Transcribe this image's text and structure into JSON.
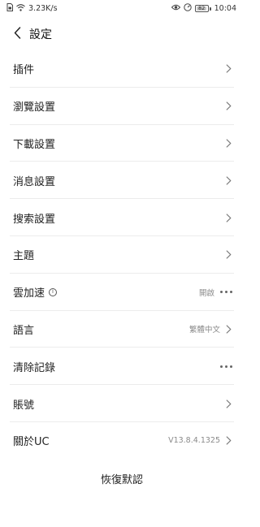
{
  "status_bar": {
    "network_speed": "3.23K/s",
    "battery_level": "82",
    "time": "10:04",
    "icons": [
      "sim-card-icon",
      "wifi-icon",
      "eye-icon",
      "speedometer-icon",
      "battery-icon"
    ]
  },
  "header": {
    "back_icon": "chevron-left-icon",
    "title": "設定"
  },
  "settings": {
    "plugins": {
      "label": "插件"
    },
    "browse": {
      "label": "瀏覽設置"
    },
    "download": {
      "label": "下載設置"
    },
    "messages": {
      "label": "消息設置"
    },
    "search": {
      "label": "搜索設置"
    },
    "theme": {
      "label": "主題"
    },
    "cloud_accel": {
      "label": "雲加速",
      "info_icon": "i",
      "value": "開啟"
    },
    "language": {
      "label": "語言",
      "value": "繁體中文"
    },
    "clear_records": {
      "label": "清除記錄"
    },
    "account": {
      "label": "賬號"
    },
    "about": {
      "label": "關於UC",
      "value": "V13.8.4.1325"
    }
  },
  "footer": {
    "restore_label": "恢復默認"
  },
  "colors": {
    "background": "#ffffff",
    "text": "#222222",
    "secondary_text": "#8a8a8a",
    "divider": "#ececec"
  }
}
